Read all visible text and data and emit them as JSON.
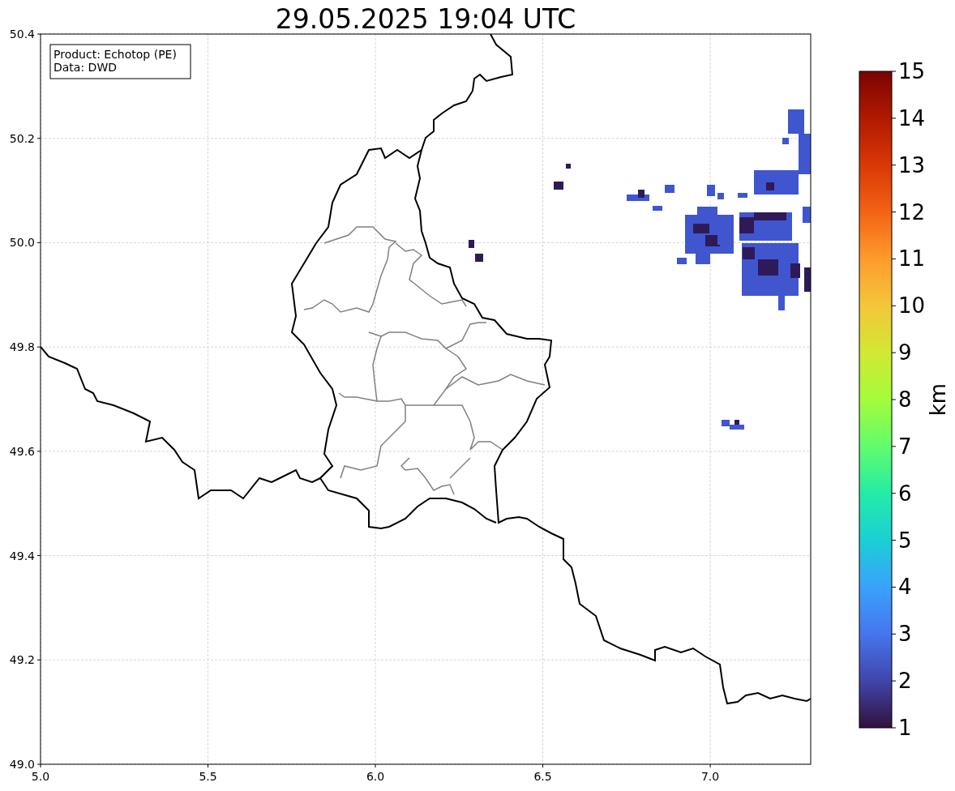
{
  "title": "29.05.2025 19:04 UTC",
  "legend": {
    "lines": [
      "Product: Echotop (PE)",
      "Data: DWD"
    ]
  },
  "x_axis": {
    "ticks": [
      "5.0",
      "5.5",
      "6.0",
      "6.5",
      "7.0"
    ]
  },
  "y_axis": {
    "ticks": [
      "50.4",
      "50.2",
      "50.0",
      "49.8",
      "49.6",
      "49.4",
      "49.2",
      "49.0"
    ]
  },
  "colorbar": {
    "label": "km",
    "ticks": [
      "15",
      "14",
      "13",
      "12",
      "11",
      "10",
      "9",
      "8",
      "7",
      "6",
      "5",
      "4",
      "3",
      "2",
      "1"
    ]
  }
}
